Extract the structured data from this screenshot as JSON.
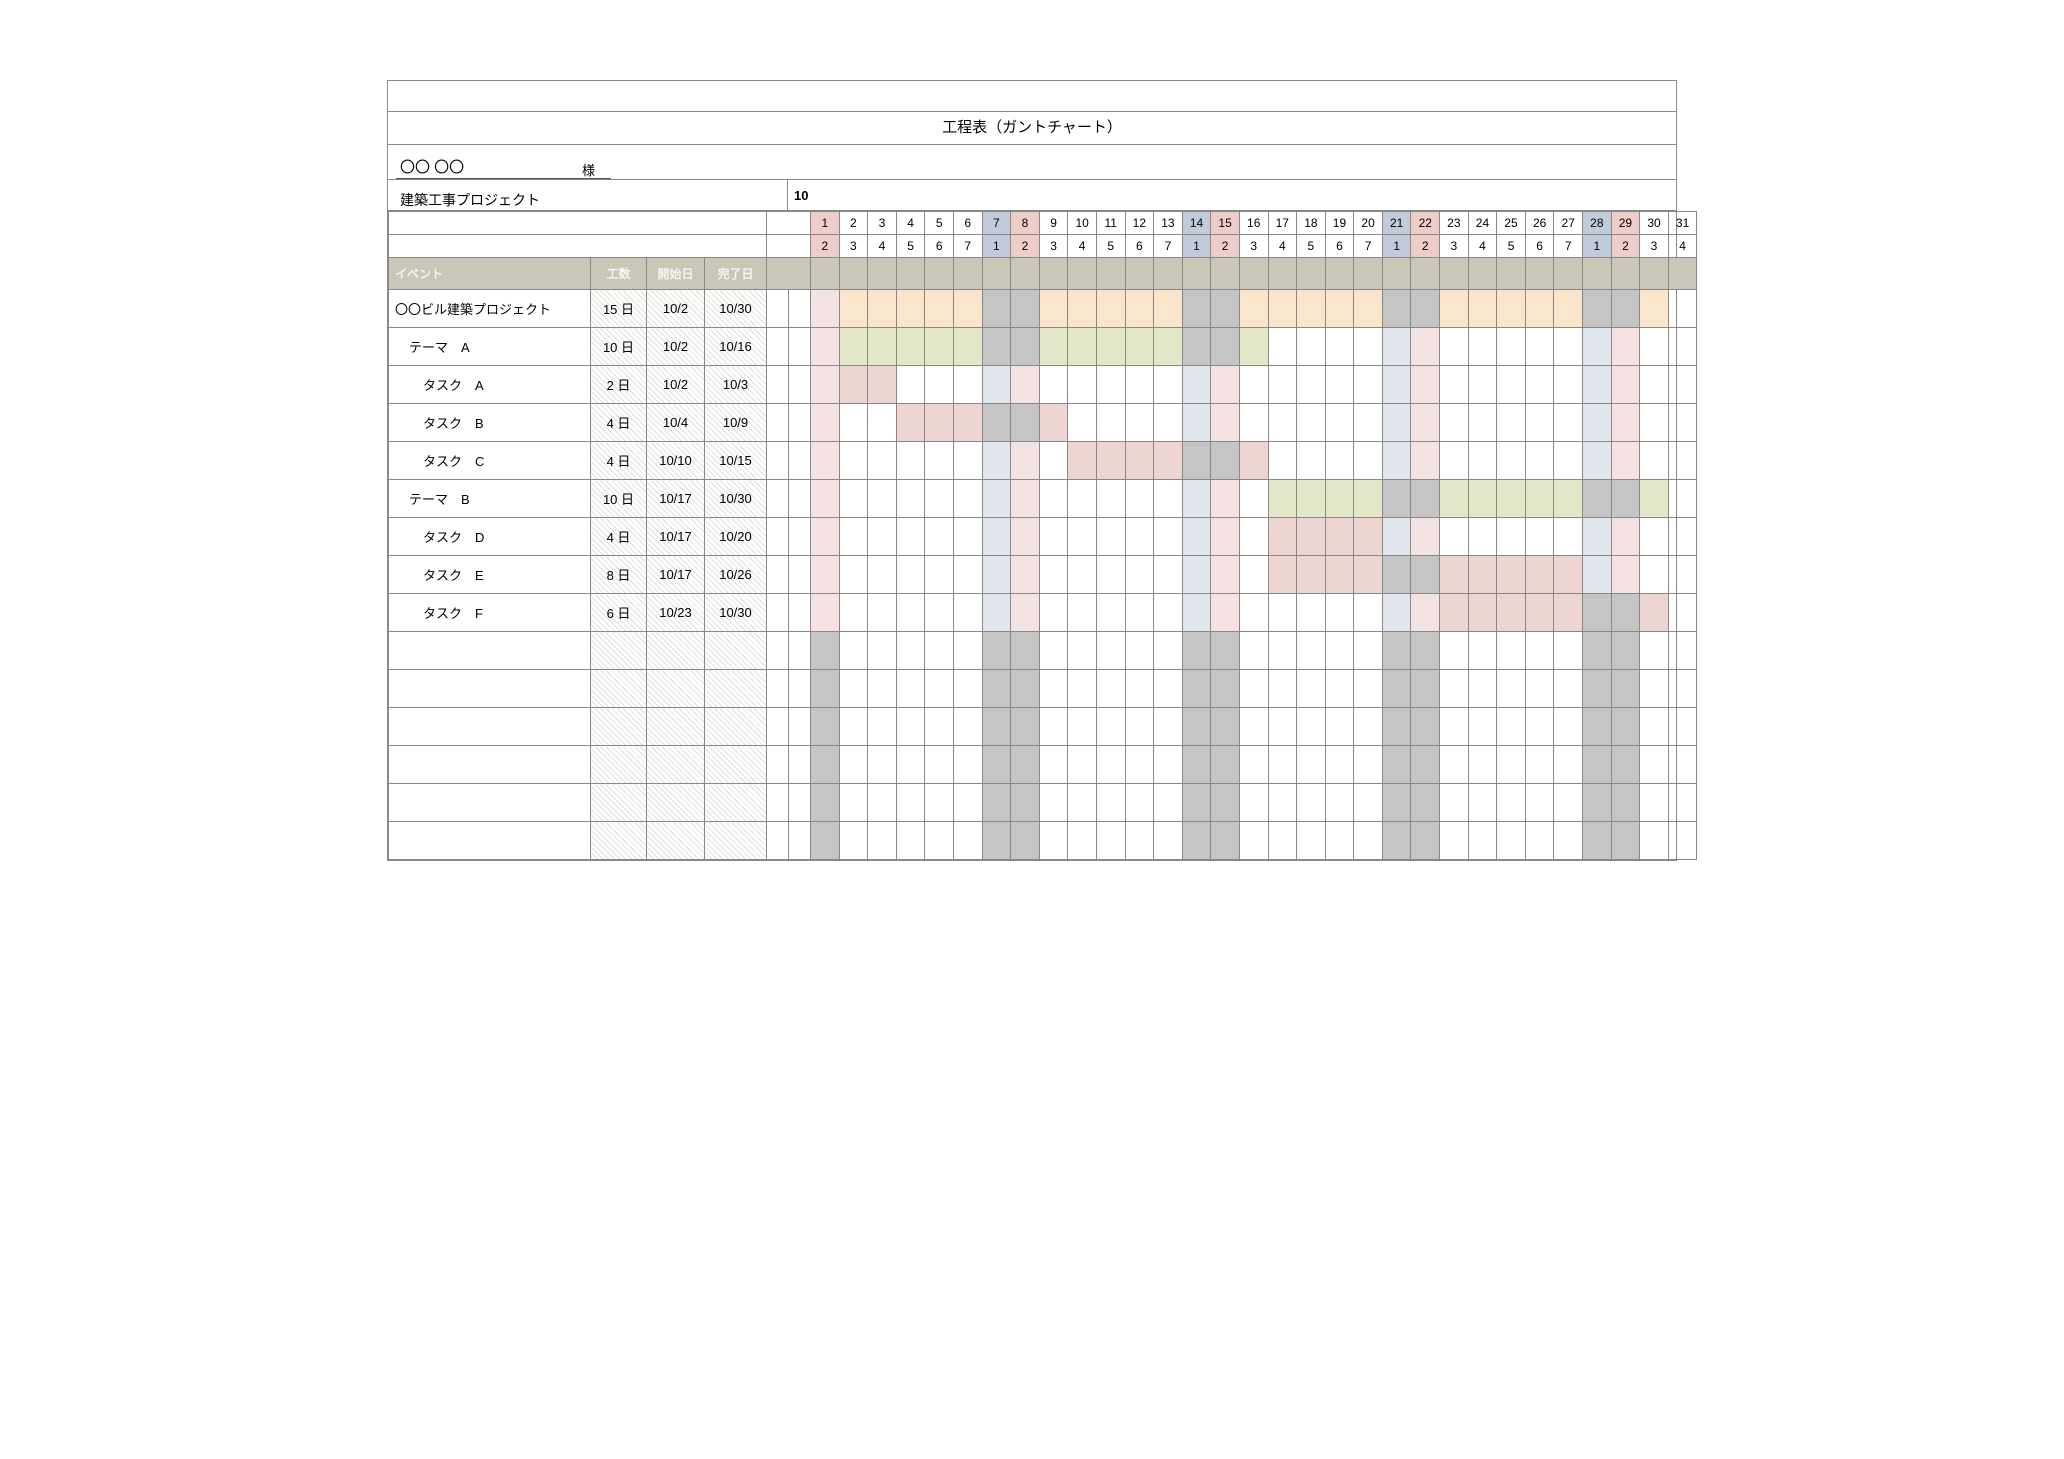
{
  "title": "工程表（ガントチャート）",
  "client_name": "〇〇 〇〇",
  "client_suffix": "様",
  "project_name": "建築工事プロジェクト",
  "month_label": "10",
  "headers": {
    "event": "イベント",
    "days": "工数",
    "start": "開始日",
    "end": "完了日"
  },
  "calendar_days": [
    1,
    2,
    3,
    4,
    5,
    6,
    7,
    8,
    9,
    10,
    11,
    12,
    13,
    14,
    15,
    16,
    17,
    18,
    19,
    20,
    21,
    22,
    23,
    24,
    25,
    26,
    27,
    28,
    29,
    30,
    31
  ],
  "calendar_wday": [
    2,
    3,
    4,
    5,
    6,
    7,
    1,
    2,
    3,
    4,
    5,
    6,
    7,
    1,
    2,
    3,
    4,
    5,
    6,
    7,
    1,
    2,
    3,
    4,
    5,
    6,
    7,
    1,
    2,
    3,
    4
  ],
  "weekend_days": {
    "sun": [
      1,
      8,
      15,
      22,
      29
    ],
    "sat": [
      7,
      14,
      21,
      28
    ]
  },
  "chart_data": {
    "type": "gantt",
    "x_axis": {
      "month": 10,
      "days": [
        1,
        31
      ]
    },
    "rows": [
      {
        "name": "〇〇ビル建築プロジェクト",
        "indent": 0,
        "days": "15 日",
        "start": "10/2",
        "end": "10/30",
        "bars": [
          [
            2,
            30,
            "orange"
          ]
        ]
      },
      {
        "name": "テーマ　A",
        "indent": 1,
        "days": "10 日",
        "start": "10/2",
        "end": "10/16",
        "bars": [
          [
            2,
            16,
            "green"
          ]
        ]
      },
      {
        "name": "タスク　A",
        "indent": 2,
        "days": "2 日",
        "start": "10/2",
        "end": "10/3",
        "bars": [
          [
            2,
            3,
            "pink"
          ]
        ]
      },
      {
        "name": "タスク　B",
        "indent": 2,
        "days": "4 日",
        "start": "10/4",
        "end": "10/9",
        "bars": [
          [
            4,
            9,
            "pink"
          ]
        ]
      },
      {
        "name": "タスク　C",
        "indent": 2,
        "days": "4 日",
        "start": "10/10",
        "end": "10/15",
        "bars": [
          [
            10,
            15,
            "pink"
          ],
          [
            16,
            16,
            "pink"
          ]
        ]
      },
      {
        "name": "テーマ　B",
        "indent": 1,
        "days": "10 日",
        "start": "10/17",
        "end": "10/30",
        "bars": [
          [
            17,
            30,
            "green"
          ]
        ]
      },
      {
        "name": "タスク　D",
        "indent": 2,
        "days": "4 日",
        "start": "10/17",
        "end": "10/20",
        "bars": [
          [
            17,
            20,
            "pink"
          ]
        ]
      },
      {
        "name": "タスク　E",
        "indent": 2,
        "days": "8 日",
        "start": "10/17",
        "end": "10/26",
        "bars": [
          [
            17,
            27,
            "pink"
          ]
        ]
      },
      {
        "name": "タスク　F",
        "indent": 2,
        "days": "6 日",
        "start": "10/23",
        "end": "10/30",
        "bars": [
          [
            23,
            30,
            "pink"
          ]
        ]
      }
    ],
    "empty_rows": 6
  }
}
